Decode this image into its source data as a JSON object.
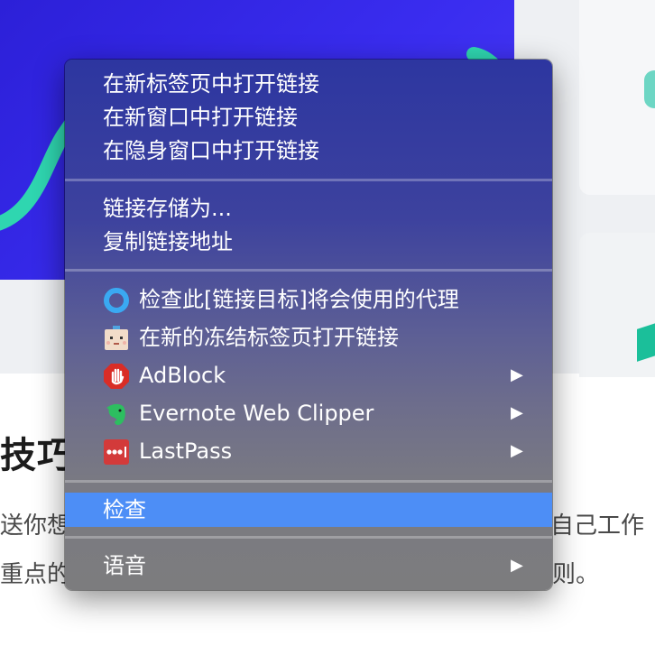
{
  "background": {
    "heading": "技巧",
    "text_line1_left": "送你想",
    "text_line1_right": "自己工作",
    "text_line2_left": "重点的",
    "text_line2_right": "则。"
  },
  "menu": {
    "open_new_tab": "在新标签页中打开链接",
    "open_new_window": "在新窗口中打开链接",
    "open_incognito": "在隐身窗口中打开链接",
    "save_link_as": "链接存储为...",
    "copy_link_address": "复制链接地址",
    "check_proxy": "检查此[链接目标]将会使用的代理",
    "open_frozen_tab": "在新的冻结标签页打开链接",
    "adblock": "AdBlock",
    "evernote": "Evernote Web Clipper",
    "lastpass": "LastPass",
    "inspect": "检查",
    "speech": "语音"
  },
  "colors": {
    "menu_highlight": "#4d8ef6",
    "hero_blue": "#2b1fd6",
    "hero_line": "#2fd6b0",
    "adblock_red": "#d92d26",
    "evernote_green": "#2dbe60",
    "lastpass_red": "#d33a3a",
    "proxy_ring": "#3aa9f2"
  },
  "icons": {
    "proxy": "proxy-ring-icon",
    "frozen_tab": "frozen-tab-face-icon",
    "adblock": "adblock-hand-icon",
    "evernote": "evernote-elephant-icon",
    "lastpass": "lastpass-dots-icon",
    "submenu": "chevron-right-icon"
  }
}
